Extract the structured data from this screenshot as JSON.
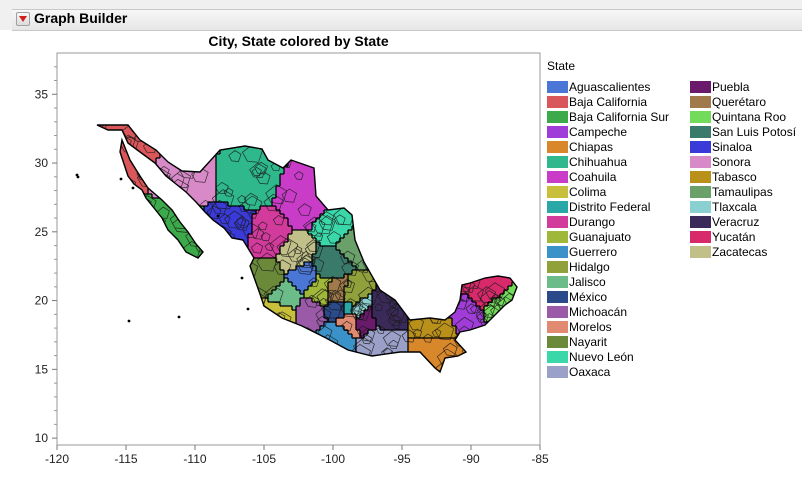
{
  "window": {
    "title": "Graph Builder"
  },
  "chart_data": {
    "type": "map",
    "title": "City, State colored by State",
    "xlabel": "",
    "ylabel": "",
    "xlim": [
      -120,
      -85
    ],
    "ylim": [
      9.5,
      38
    ],
    "x_ticks": [
      -120,
      -115,
      -110,
      -105,
      -100,
      -95,
      -90,
      -85
    ],
    "y_ticks": [
      10,
      15,
      20,
      25,
      30,
      35
    ],
    "legend_title": "State",
    "legend_position": "right",
    "series": [
      {
        "name": "Aguascalientes",
        "color": "#4a76d6",
        "center": [
          -102.3,
          21.9
        ]
      },
      {
        "name": "Baja California",
        "color": "#d9565a",
        "center": [
          -115.2,
          30.8
        ]
      },
      {
        "name": "Baja California Sur",
        "color": "#3caa4a",
        "center": [
          -111.5,
          25.3
        ]
      },
      {
        "name": "Campeche",
        "color": "#a03cd8",
        "center": [
          -90.4,
          19.0
        ]
      },
      {
        "name": "Chiapas",
        "color": "#d8872a",
        "center": [
          -92.6,
          16.6
        ]
      },
      {
        "name": "Chihuahua",
        "color": "#2eb88c",
        "center": [
          -106.5,
          29.0
        ]
      },
      {
        "name": "Coahuila",
        "color": "#c83cc8",
        "center": [
          -102.0,
          27.3
        ]
      },
      {
        "name": "Colima",
        "color": "#c8c03a",
        "center": [
          -104.0,
          19.2
        ]
      },
      {
        "name": "Distrito Federal",
        "color": "#2aa8a8",
        "center": [
          -99.1,
          19.4
        ]
      },
      {
        "name": "Durango",
        "color": "#d23a9c",
        "center": [
          -104.9,
          24.5
        ]
      },
      {
        "name": "Guanajuato",
        "color": "#a0b83a",
        "center": [
          -101.0,
          21.0
        ]
      },
      {
        "name": "Guerrero",
        "color": "#3a92c8",
        "center": [
          -100.0,
          17.6
        ]
      },
      {
        "name": "Hidalgo",
        "color": "#90a03a",
        "center": [
          -98.8,
          20.5
        ]
      },
      {
        "name": "Jalisco",
        "color": "#6cbc8a",
        "center": [
          -103.6,
          20.5
        ]
      },
      {
        "name": "México",
        "color": "#2a4a8a",
        "center": [
          -99.6,
          19.4
        ]
      },
      {
        "name": "Michoacán",
        "color": "#9a5aa8",
        "center": [
          -101.8,
          19.2
        ]
      },
      {
        "name": "Morelos",
        "color": "#e08a72",
        "center": [
          -99.1,
          18.8
        ]
      },
      {
        "name": "Nayarit",
        "color": "#6a8a3a",
        "center": [
          -104.9,
          21.8
        ]
      },
      {
        "name": "Nuevo León",
        "color": "#3ad8a8",
        "center": [
          -99.9,
          25.6
        ]
      },
      {
        "name": "Oaxaca",
        "color": "#9aa0c8",
        "center": [
          -96.7,
          17.0
        ]
      },
      {
        "name": "Puebla",
        "color": "#6a1a6a",
        "center": [
          -97.9,
          19.0
        ]
      },
      {
        "name": "Querétaro",
        "color": "#a07a4a",
        "center": [
          -99.9,
          20.8
        ]
      },
      {
        "name": "Quintana Roo",
        "color": "#72dc5a",
        "center": [
          -88.1,
          19.6
        ]
      },
      {
        "name": "San Luis Potosí",
        "color": "#3a7a6a",
        "center": [
          -100.4,
          22.6
        ]
      },
      {
        "name": "Sinaloa",
        "color": "#3a3ad8",
        "center": [
          -107.5,
          25.0
        ]
      },
      {
        "name": "Sonora",
        "color": "#d88ac8",
        "center": [
          -110.7,
          29.3
        ]
      },
      {
        "name": "Tabasco",
        "color": "#b8901a",
        "center": [
          -92.6,
          18.0
        ]
      },
      {
        "name": "Tamaulipas",
        "color": "#6aa06a",
        "center": [
          -98.7,
          24.3
        ]
      },
      {
        "name": "Tlaxcala",
        "color": "#8ad0d0",
        "center": [
          -98.2,
          19.4
        ]
      },
      {
        "name": "Veracruz",
        "color": "#3a2a5a",
        "center": [
          -96.6,
          19.3
        ]
      },
      {
        "name": "Yucatán",
        "color": "#d82a6a",
        "center": [
          -89.0,
          20.7
        ]
      },
      {
        "name": "Zacatecas",
        "color": "#c0c088",
        "center": [
          -102.9,
          23.3
        ]
      }
    ]
  }
}
